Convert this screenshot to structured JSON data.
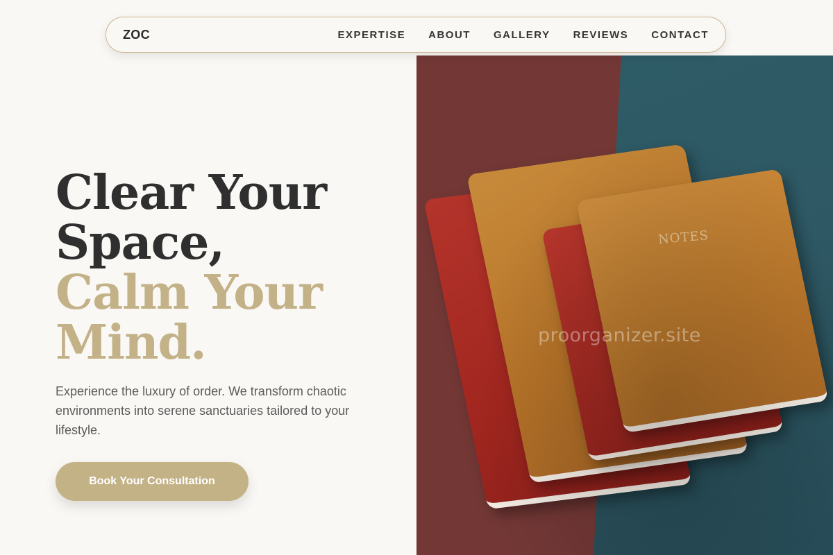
{
  "header": {
    "logo": "ZOC",
    "nav": [
      {
        "label": "EXPERTISE"
      },
      {
        "label": "ABOUT"
      },
      {
        "label": "GALLERY"
      },
      {
        "label": "REVIEWS"
      },
      {
        "label": "CONTACT"
      }
    ]
  },
  "hero": {
    "headline_line_1": "Clear Your",
    "headline_line_2": "Space,",
    "headline_line_3": "Calm Your",
    "headline_line_4": "Mind.",
    "subtitle": "Experience the luxury of order. We transform chaotic environments into serene sanctuaries tailored to your lifestyle.",
    "cta_label": "Book Your Consultation",
    "image_label_text": "NOTES",
    "watermark": "proorganizer.site"
  },
  "colors": {
    "background": "#faf8f4",
    "accent": "#c4b287",
    "text_dark": "#2f2f2f"
  }
}
